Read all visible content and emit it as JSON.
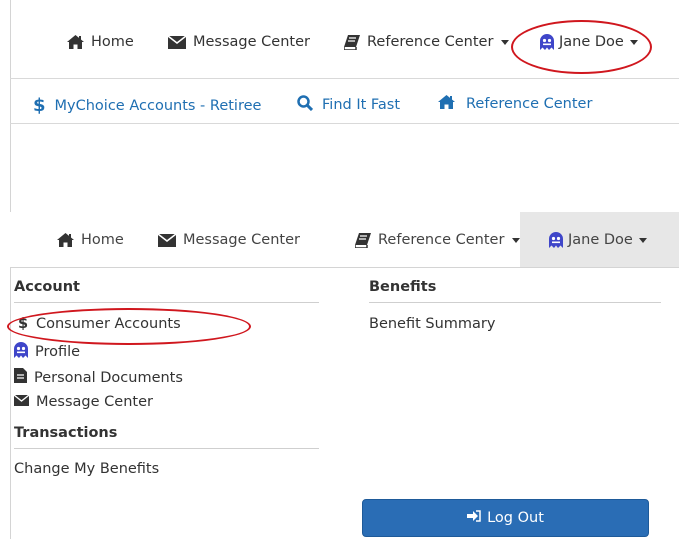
{
  "top_nav": {
    "home": "Home",
    "message_center": "Message Center",
    "reference_center": "Reference Center",
    "user": "Jane Doe"
  },
  "sub_nav": {
    "accounts": "MyChoice Accounts - Retiree",
    "find_it_fast": "Find It Fast",
    "reference_center": "Reference Center"
  },
  "second_nav": {
    "home": "Home",
    "message_center": "Message Center",
    "reference_center": "Reference Center",
    "user": "Jane Doe"
  },
  "dropdown": {
    "account_heading": "Account",
    "account_items": [
      "Consumer Accounts",
      "Profile",
      "Personal Documents",
      "Message Center"
    ],
    "transactions_heading": "Transactions",
    "transactions_items": [
      "Change My Benefits"
    ],
    "benefits_heading": "Benefits",
    "benefits_items": [
      "Benefit Summary"
    ],
    "logout": "Log Out"
  },
  "colors": {
    "accent": "#1f6fb2",
    "highlight_oval": "#d0171e",
    "button": "#2a6db5",
    "ghost_icon": "#3f46c9"
  },
  "icons": [
    "home-icon",
    "envelope-icon",
    "book-icon",
    "ghost-user-icon",
    "dollar-icon",
    "search-icon",
    "document-icon",
    "logout-icon"
  ]
}
